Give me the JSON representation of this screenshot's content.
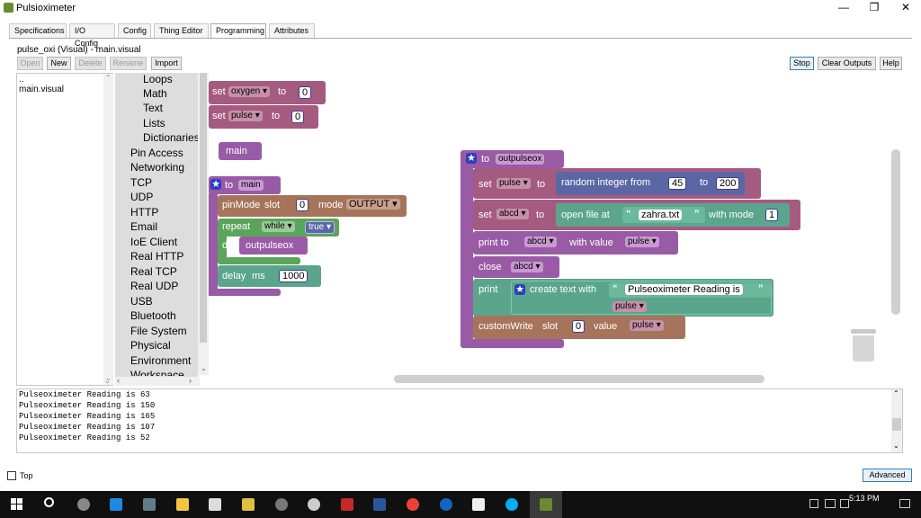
{
  "window": {
    "title": "Pulsioximeter",
    "min": "—",
    "max": "❐",
    "close": "✕"
  },
  "tabs": [
    "Specifications",
    "I/O Config",
    "Config",
    "Thing Editor",
    "Programming",
    "Attributes"
  ],
  "file_title": "pulse_oxi (Visual) - main.visual",
  "toolbar": {
    "open": "Open",
    "new": "New",
    "delete": "Delete",
    "rename": "Rename",
    "import": "Import",
    "stop": "Stop",
    "clear_outputs": "Clear Outputs",
    "help": "Help"
  },
  "files": [
    "..",
    "main.visual"
  ],
  "categories": [
    "Loops",
    "Math",
    "Text",
    "Lists",
    "Dictionaries",
    "Pin Access",
    "Networking",
    "TCP",
    "UDP",
    "HTTP",
    "Email",
    "IoE Client",
    "Real HTTP",
    "Real TCP",
    "Real UDP",
    "USB",
    "Bluetooth",
    "File System",
    "Physical",
    "Environment",
    "Workspace"
  ],
  "blocks": {
    "set": "set",
    "to": "to",
    "oxygen": "oxygen",
    "pulse": "pulse",
    "zero": "0",
    "main": "main",
    "pinMode": "pinMode",
    "slot": "slot",
    "mode": "mode",
    "output": "OUTPUT",
    "repeat": "repeat",
    "while": "while",
    "true": "true",
    "do": "do",
    "outpulseox": "outpulseox",
    "delay": "delay",
    "ms": "ms",
    "delay_val": "1000",
    "random": "random integer from",
    "from_val": "45",
    "to_val": "200",
    "abcd": "abcd",
    "open_file": "open file at",
    "filename": "zahra.txt",
    "with_mode": "with mode",
    "mode_val": "1",
    "print_to": "print to",
    "with_value": "with value",
    "close": "close",
    "print": "print",
    "create_text": "create text with",
    "reading": "Pulseoximeter Reading is",
    "customWrite": "customWrite",
    "value": "value",
    "quote_open": "“",
    "quote_close": "”",
    "dd": "▾",
    "star": "★"
  },
  "output_lines": [
    "Pulseoximeter Reading is 63",
    "Pulseoximeter Reading is 150",
    "Pulseoximeter Reading is 165",
    "Pulseoximeter Reading is 107",
    "Pulseoximeter Reading is 52"
  ],
  "footer": {
    "top_label": "Top",
    "advanced": "Advanced"
  },
  "clock": {
    "time": "5:13 PM"
  },
  "colors": {
    "variable_block": "#a55b80",
    "procedure_block": "#995ba5",
    "arduino_block": "#a5745b",
    "loop_block": "#5ba55b",
    "math_block": "#5b67a5",
    "text_block": "#5ba58c",
    "accent": "#3c7fb1"
  }
}
